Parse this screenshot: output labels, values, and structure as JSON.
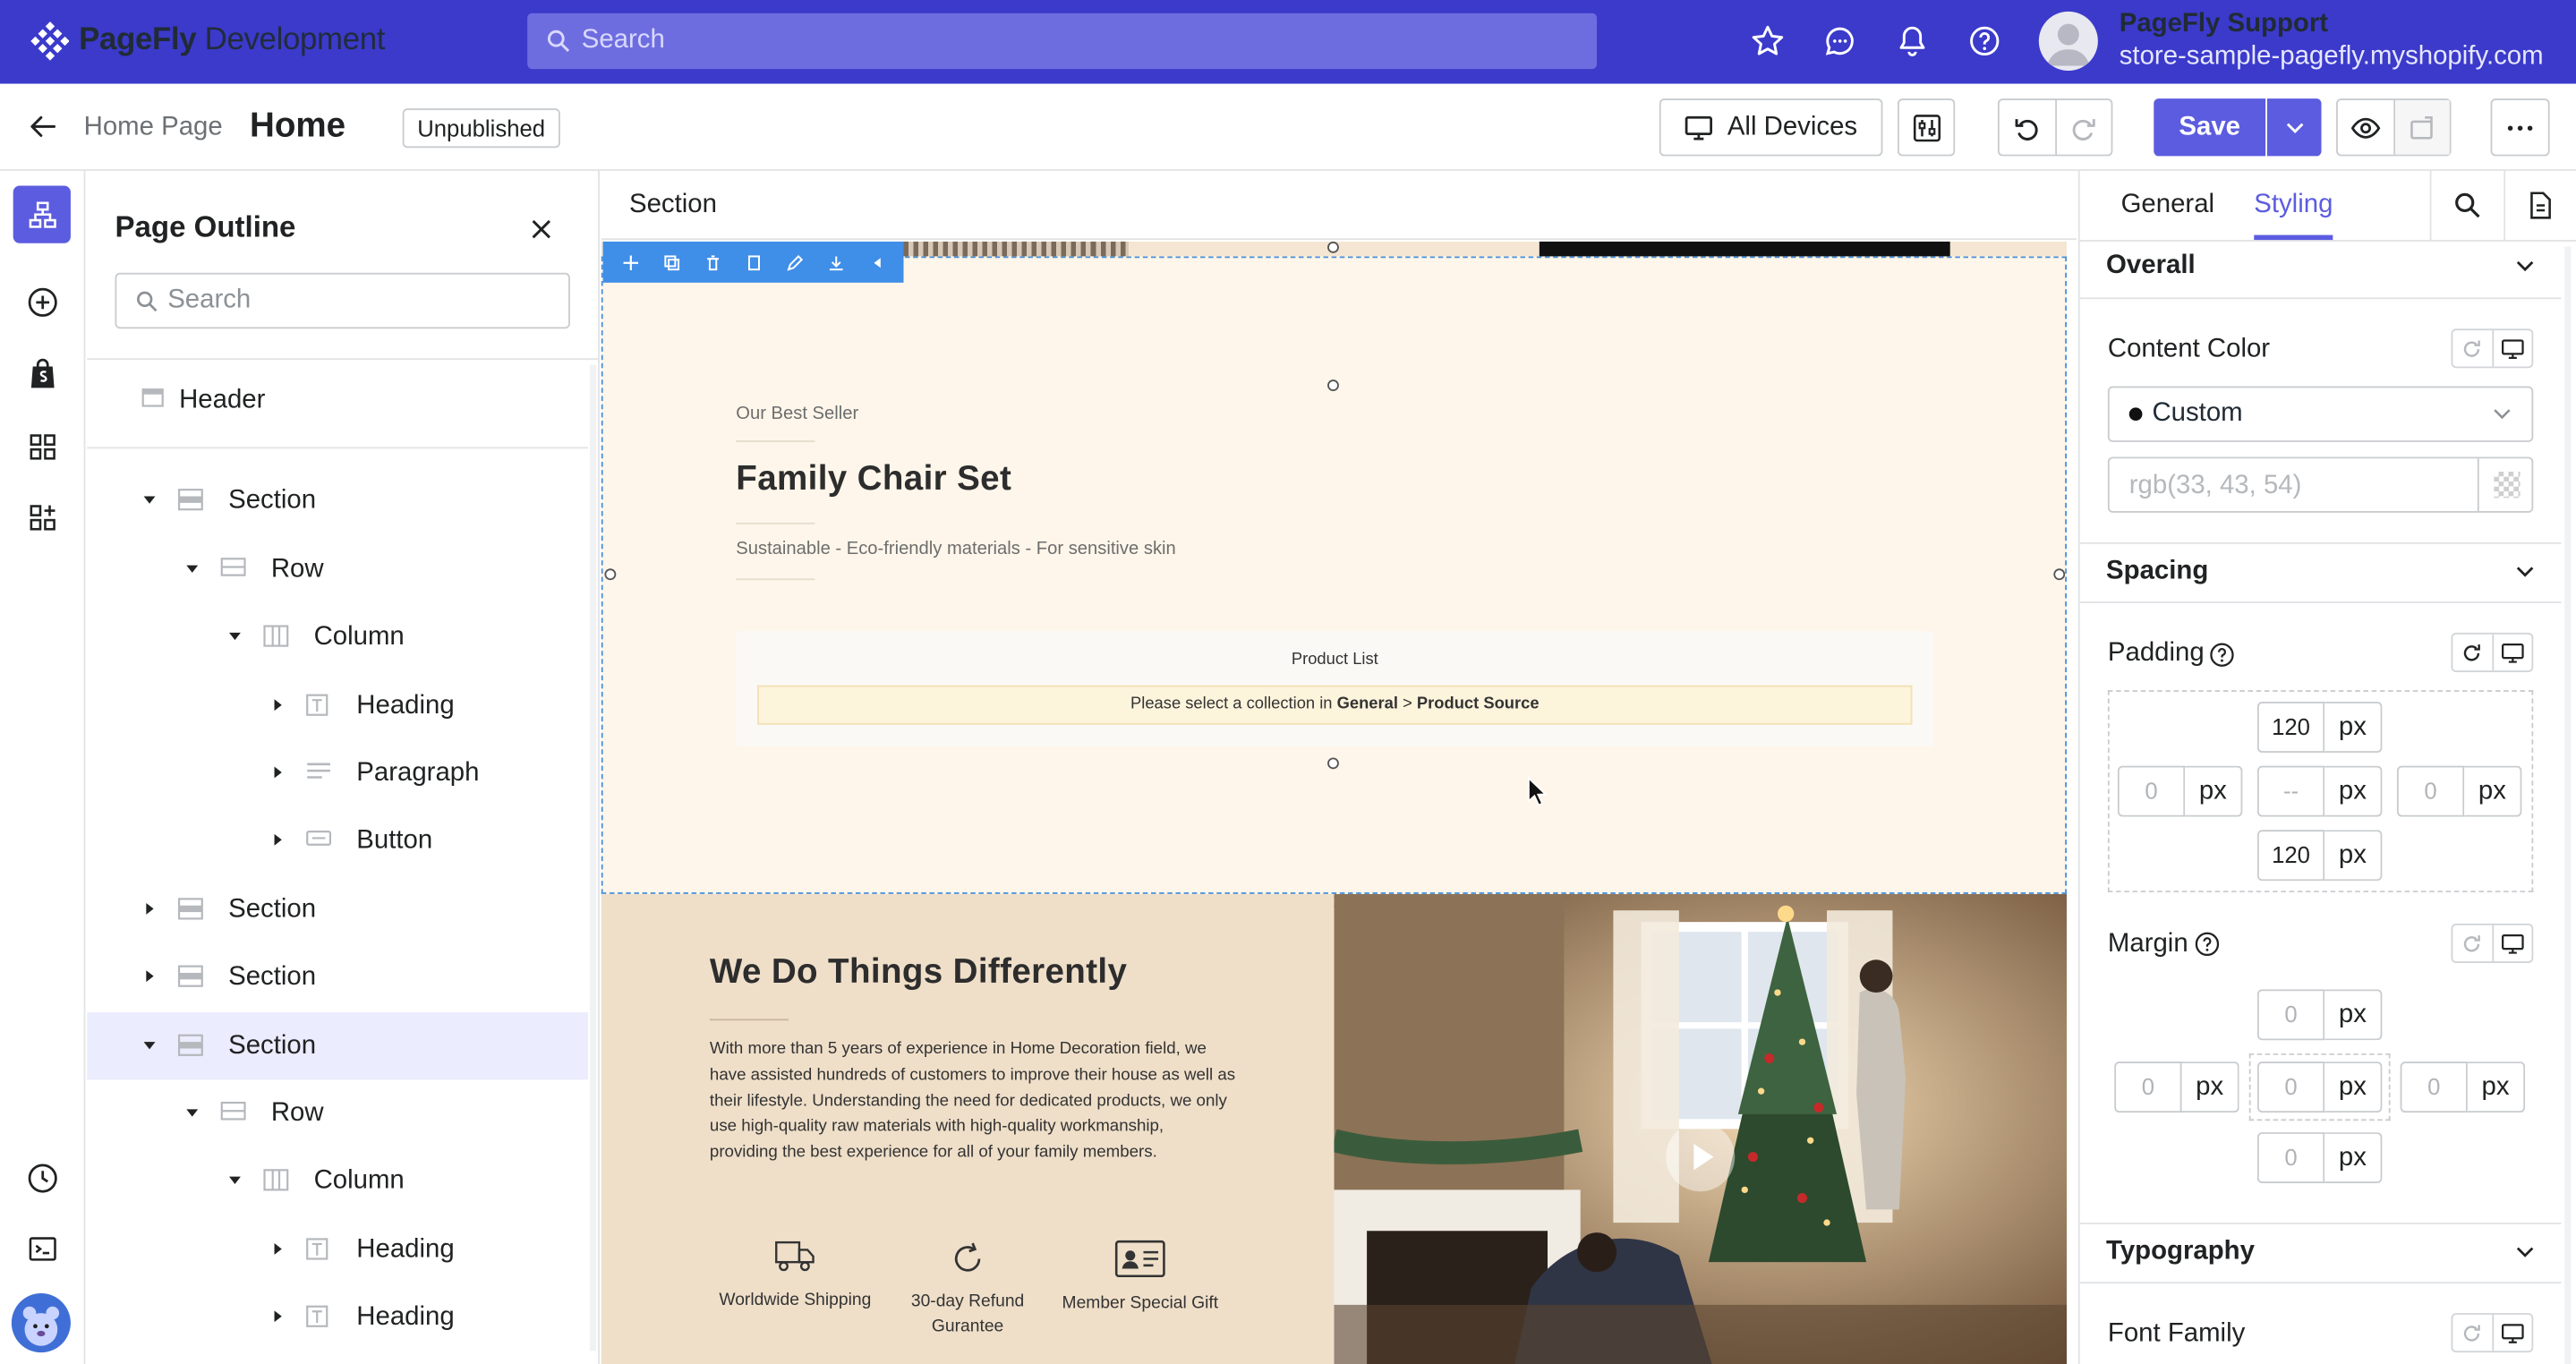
{
  "app": {
    "brand": "PageFly",
    "env": "Development",
    "search_placeholder": "Search",
    "account_name": "PageFly Support",
    "account_store": "store-sample-pagefly.myshopify.com"
  },
  "toolbar": {
    "breadcrumb": "Home Page",
    "page_title": "Home",
    "status": "Unpublished",
    "device": "All Devices",
    "save": "Save"
  },
  "outline": {
    "title": "Page Outline",
    "search_placeholder": "Search",
    "items": [
      {
        "label": "Header",
        "type": "header",
        "depth": 0,
        "expanded": null,
        "selected": false
      },
      {
        "label": "Section",
        "type": "section",
        "depth": 0,
        "expanded": true,
        "selected": false
      },
      {
        "label": "Row",
        "type": "row",
        "depth": 1,
        "expanded": true,
        "selected": false
      },
      {
        "label": "Column",
        "type": "column",
        "depth": 2,
        "expanded": true,
        "selected": false
      },
      {
        "label": "Heading",
        "type": "heading",
        "depth": 3,
        "expanded": false,
        "selected": false
      },
      {
        "label": "Paragraph",
        "type": "paragraph",
        "depth": 3,
        "expanded": false,
        "selected": false
      },
      {
        "label": "Button",
        "type": "button",
        "depth": 3,
        "expanded": false,
        "selected": false
      },
      {
        "label": "Section",
        "type": "section",
        "depth": 0,
        "expanded": false,
        "selected": false
      },
      {
        "label": "Section",
        "type": "section",
        "depth": 0,
        "expanded": false,
        "selected": false
      },
      {
        "label": "Section",
        "type": "section",
        "depth": 0,
        "expanded": true,
        "selected": true
      },
      {
        "label": "Row",
        "type": "row",
        "depth": 1,
        "expanded": true,
        "selected": false
      },
      {
        "label": "Column",
        "type": "column",
        "depth": 2,
        "expanded": true,
        "selected": false
      },
      {
        "label": "Heading",
        "type": "heading",
        "depth": 3,
        "expanded": false,
        "selected": false
      },
      {
        "label": "Heading",
        "type": "heading",
        "depth": 3,
        "expanded": false,
        "selected": false
      }
    ]
  },
  "canvas": {
    "selected_label": "Section",
    "hero": {
      "eyebrow": "Our Best Seller",
      "title": "Family Chair Set",
      "subtitle": "Sustainable - Eco-friendly materials - For sensitive skin",
      "product_list_title": "Product List",
      "product_list_msg_prefix": "Please select a collection in ",
      "product_list_msg_general": "General",
      "product_list_msg_sep": " > ",
      "product_list_msg_source": "Product Source"
    },
    "about": {
      "title": "We Do Things Differently",
      "body": "With more than 5 years of experience in Home Decoration field, we have assisted hundreds of customers to improve their house as well as their lifestyle. Understanding the need for dedicated products, we only use high-quality raw materials with high-quality workmanship, providing the best experience for all of your family members.",
      "features": [
        {
          "label": "Worldwide Shipping",
          "icon": "truck-icon"
        },
        {
          "label": "30-day Refund Gurantee",
          "icon": "refresh-icon"
        },
        {
          "label": "Member Special Gift",
          "icon": "member-card-icon"
        }
      ]
    }
  },
  "inspector": {
    "tabs": [
      "General",
      "Styling"
    ],
    "active_tab": "Styling",
    "overall": "Overall",
    "content_color_label": "Content Color",
    "content_color_mode": "Custom",
    "content_color_placeholder": "rgb(33, 43, 54)",
    "spacing": "Spacing",
    "padding_label": "Padding",
    "padding": {
      "top": "120",
      "right": "0",
      "bottom": "120",
      "left": "0",
      "center": "--",
      "unit": "px"
    },
    "margin_label": "Margin",
    "margin": {
      "top": "0",
      "right": "0",
      "bottom": "0",
      "left": "0",
      "center": "0",
      "unit": "px"
    },
    "typography": "Typography",
    "font_family_label": "Font Family"
  },
  "colors": {
    "brand": "#3b3acb",
    "accent": "#5c5ce0",
    "hero_bg": "#fef6ea",
    "about_bg": "#efdfc9",
    "selection": "#3f8ee8"
  }
}
